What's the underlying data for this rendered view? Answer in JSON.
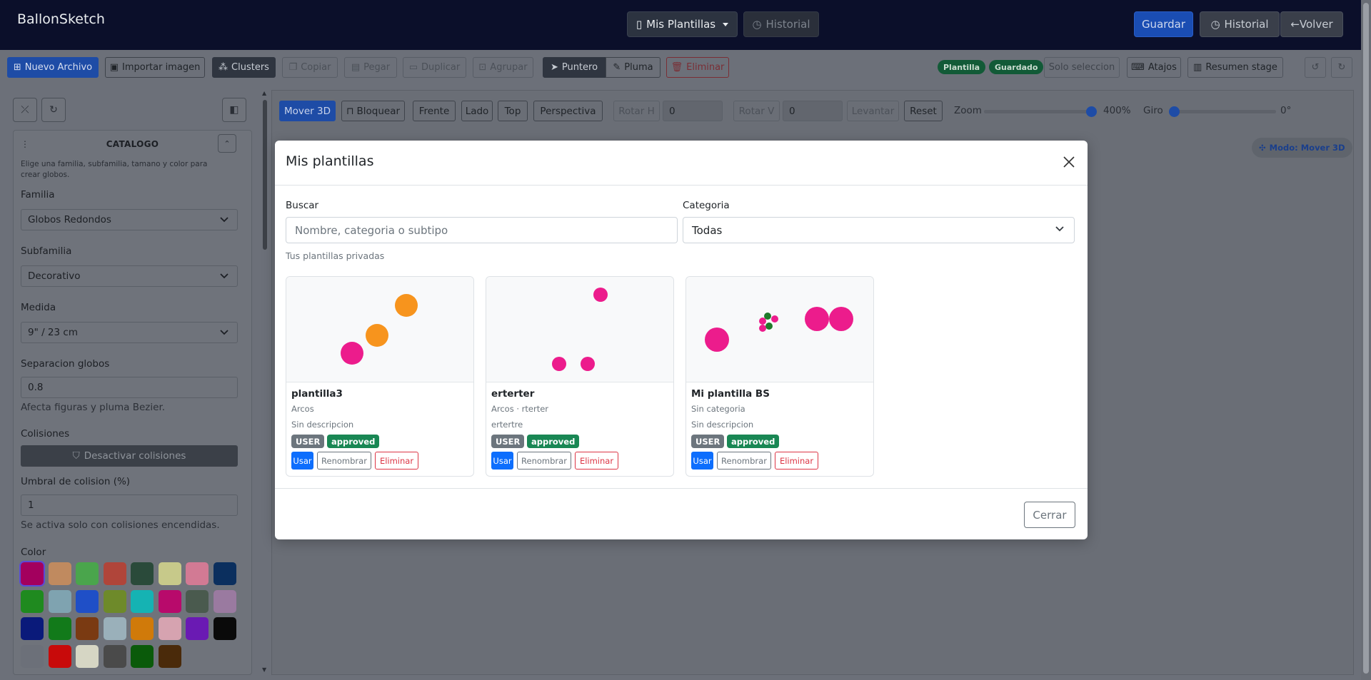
{
  "navbar": {
    "brand": "BallonSketch",
    "templates_menu": "Mis Plantillas",
    "history_center": "Historial",
    "save": "Guardar",
    "history_right": "Historial",
    "back": "←Volver"
  },
  "toolbar": {
    "new_file": "Nuevo Archivo",
    "import_image": "Importar imagen",
    "clusters": "Clusters",
    "copy": "Copiar",
    "paste": "Pegar",
    "duplicate": "Duplicar",
    "group": "Agrupar",
    "pointer": "Puntero",
    "pen": "Pluma",
    "delete": "Eliminar",
    "badge_template": "Plantilla",
    "badge_saved": "Guardado",
    "selection_only": "Solo seleccion",
    "shortcuts": "Atajos",
    "stage_summary": "Resumen stage"
  },
  "catalog": {
    "title": "CATALOGO",
    "help": "Elige una familia, subfamilia, tamano y color para crear globos.",
    "family_label": "Familia",
    "family_value": "Globos Redondos",
    "subfamily_label": "Subfamilia",
    "subfamily_value": "Decorativo",
    "size_label": "Medida",
    "size_value": "9\" / 23 cm",
    "separation_label": "Separacion globos",
    "separation_value": "0.8",
    "separation_hint": "Afecta figuras y pluma Bezier.",
    "collisions_label": "Colisiones",
    "collisions_button": "Desactivar colisiones",
    "threshold_label": "Umbral de colision (%)",
    "threshold_value": "1",
    "threshold_hint": "Se activa solo con colisiones encendidas.",
    "color_label": "Color",
    "colors": [
      "#a3005e",
      "#c08a5f",
      "#4aa54c",
      "#b0453a",
      "#2a4a3a",
      "#c7c98a",
      "#d27a94",
      "#0b2f5e",
      "#1f8a1f",
      "#7fa3b0",
      "#1f4fc7",
      "#6e8a2a",
      "#15b3b3",
      "#b80a6b",
      "#4a5a4e",
      "#9a7aa0",
      "#0a1a7a",
      "#127a1a",
      "#7a3a12",
      "#9ab0ba",
      "#d07a0a",
      "#d6a3b0",
      "#6a1ab3",
      "#0a0a0a",
      "#6c7079",
      "#c80a0a",
      "#d6d6c4",
      "#4a4a4a",
      "#0a5a0a",
      "#4a2a0a"
    ]
  },
  "canvas_toolbar": {
    "move3d": "Mover 3D",
    "lock": "Bloquear",
    "front": "Frente",
    "side": "Lado",
    "top": "Top",
    "perspective": "Perspectiva",
    "rot_h": "Rotar H",
    "rot_h_value": "0",
    "rot_v": "Rotar V",
    "rot_v_value": "0",
    "lift": "Levantar",
    "reset": "Reset",
    "zoom_label": "Zoom",
    "zoom_value": "400%",
    "zoom_level": 1.0,
    "spin_label": "Giro",
    "spin_value": "0°",
    "spin_level": 0.0,
    "mode_badge": "Modo: Mover 3D"
  },
  "modal": {
    "title": "Mis plantillas",
    "search_label": "Buscar",
    "search_placeholder": "Nombre, categoria o subtipo",
    "category_label": "Categoria",
    "category_value": "Todas",
    "private_heading": "Tus plantillas privadas",
    "close_button": "Cerrar",
    "cards": [
      {
        "name": "plantilla3",
        "category": "Arcos",
        "description": "Sin descripcion",
        "badge_user": "USER",
        "badge_status": "approved",
        "use": "Usar",
        "rename": "Renombrar",
        "delete": "Eliminar"
      },
      {
        "name": "erterter",
        "category": "Arcos · rterter",
        "description": "ertertre",
        "badge_user": "USER",
        "badge_status": "approved",
        "use": "Usar",
        "rename": "Renombrar",
        "delete": "Eliminar"
      },
      {
        "name": "Mi plantilla BS",
        "category": "Sin categoria",
        "description": "Sin descripcion",
        "badge_user": "USER",
        "badge_status": "approved",
        "use": "Usar",
        "rename": "Renombrar",
        "delete": "Eliminar"
      }
    ]
  }
}
